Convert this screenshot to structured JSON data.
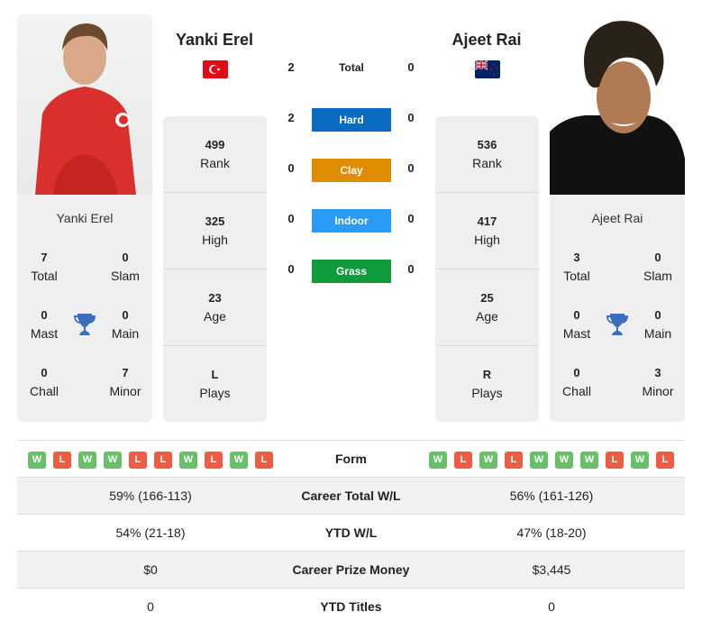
{
  "colors": {
    "hard": "#0a6cc1",
    "clay": "#e08c00",
    "indoor": "#2a9af3",
    "grass": "#0f9a3c",
    "win": "#6abf69",
    "loss": "#ee5c42",
    "trophy": "#3a6fbf"
  },
  "player1": {
    "name": "Yanki Erel",
    "flag": "turkey-flag",
    "card_name": "Yanki Erel",
    "titles": {
      "total": "7",
      "total_label": "Total",
      "slam": "0",
      "slam_label": "Slam",
      "mast": "0",
      "mast_label": "Mast",
      "main": "0",
      "main_label": "Main",
      "chall": "0",
      "chall_label": "Chall",
      "minor": "7",
      "minor_label": "Minor"
    },
    "info": [
      {
        "value": "499",
        "label": "Rank"
      },
      {
        "value": "325",
        "label": "High"
      },
      {
        "value": "23",
        "label": "Age"
      },
      {
        "value": "L",
        "label": "Plays"
      }
    ],
    "form": [
      "W",
      "L",
      "W",
      "W",
      "L",
      "L",
      "W",
      "L",
      "W",
      "L"
    ],
    "career_wl": "59% (166-113)",
    "ytd_wl": "54% (21-18)",
    "prize": "$0",
    "ytd_titles": "0"
  },
  "player2": {
    "name": "Ajeet Rai",
    "flag": "new-zealand-flag",
    "card_name": "Ajeet Rai",
    "titles": {
      "total": "3",
      "total_label": "Total",
      "slam": "0",
      "slam_label": "Slam",
      "mast": "0",
      "mast_label": "Mast",
      "main": "0",
      "main_label": "Main",
      "chall": "0",
      "chall_label": "Chall",
      "minor": "3",
      "minor_label": "Minor"
    },
    "info": [
      {
        "value": "536",
        "label": "Rank"
      },
      {
        "value": "417",
        "label": "High"
      },
      {
        "value": "25",
        "label": "Age"
      },
      {
        "value": "R",
        "label": "Plays"
      }
    ],
    "form": [
      "W",
      "L",
      "W",
      "L",
      "W",
      "W",
      "W",
      "L",
      "W",
      "L"
    ],
    "career_wl": "56% (161-126)",
    "ytd_wl": "47% (18-20)",
    "prize": "$3,445",
    "ytd_titles": "0"
  },
  "h2h": {
    "total": {
      "label": "Total",
      "p1": "2",
      "p2": "0"
    },
    "hard": {
      "label": "Hard",
      "p1": "2",
      "p2": "0"
    },
    "clay": {
      "label": "Clay",
      "p1": "0",
      "p2": "0"
    },
    "indoor": {
      "label": "Indoor",
      "p1": "0",
      "p2": "0"
    },
    "grass": {
      "label": "Grass",
      "p1": "0",
      "p2": "0"
    }
  },
  "table": {
    "form_label": "Form",
    "career_wl_label": "Career Total W/L",
    "ytd_wl_label": "YTD W/L",
    "prize_label": "Career Prize Money",
    "ytd_titles_label": "YTD Titles"
  }
}
